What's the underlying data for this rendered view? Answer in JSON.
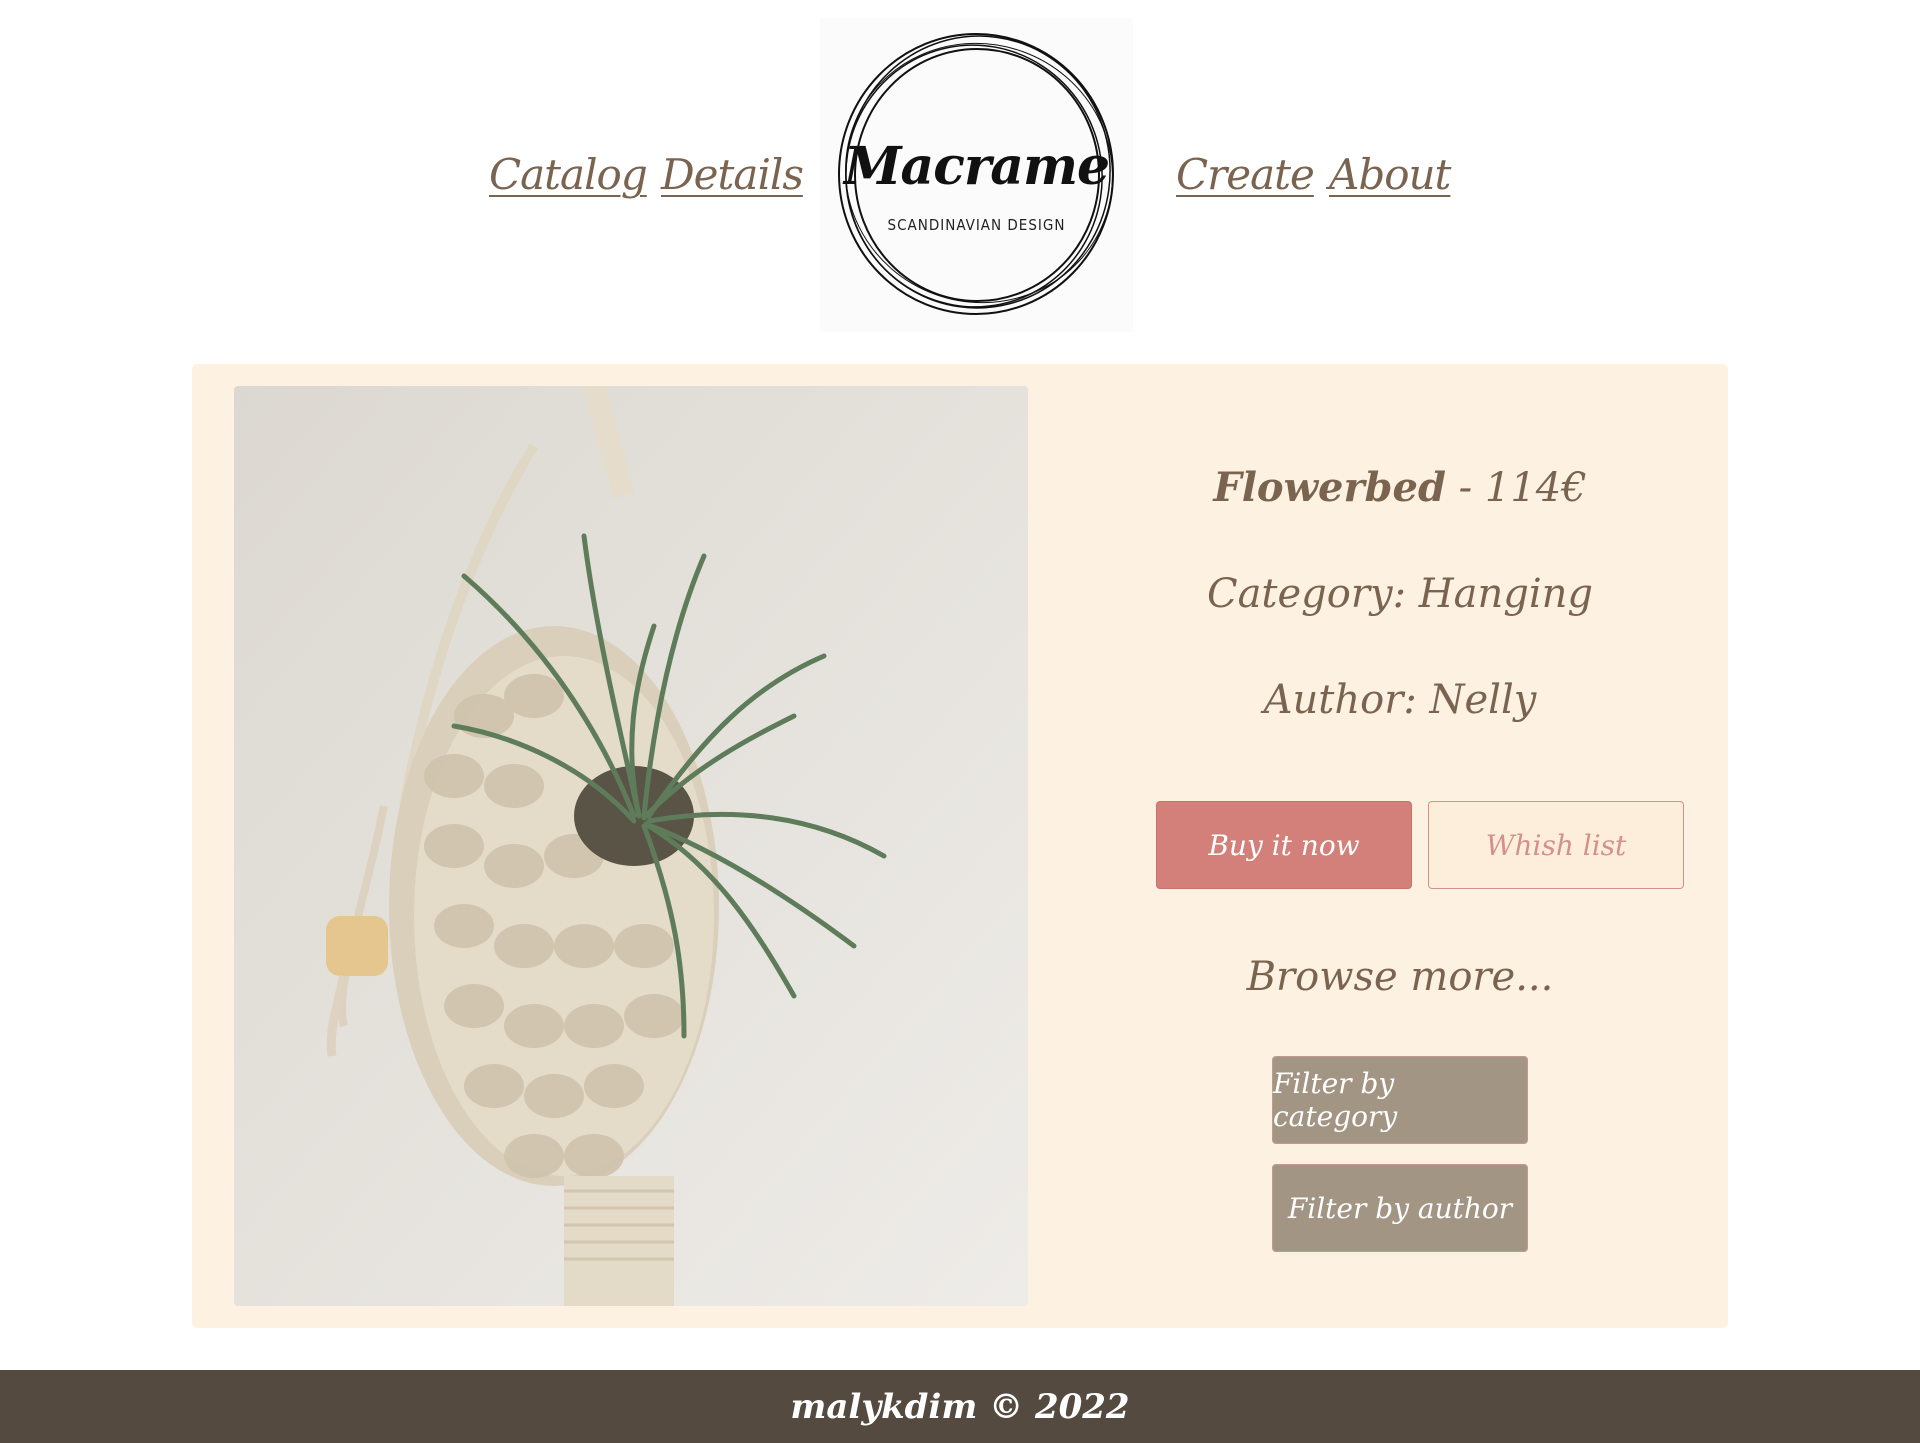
{
  "nav": {
    "left": [
      {
        "label": "Catalog"
      },
      {
        "label": "Details"
      }
    ],
    "right": [
      {
        "label": "Create"
      },
      {
        "label": "About"
      }
    ]
  },
  "logo": {
    "title": "Macrame",
    "subtitle": "SCANDINAVIAN DESIGN"
  },
  "product": {
    "name": "Flowerbed",
    "separator": " - ",
    "price": "114€",
    "category_text": "Category: Hanging",
    "author_text": "Author: Nelly",
    "buy_label": "Buy it now",
    "wish_label": "Whish list"
  },
  "browse": {
    "heading": "Browse more...",
    "filter_category_label": "Filter by category",
    "filter_author_label": "Filter by author"
  },
  "footer": {
    "text": "malykdim © 2022"
  },
  "colors": {
    "accent": "#d4807a",
    "card_bg": "#fdf1e2",
    "text": "#7a6450",
    "filter_btn": "#a39584",
    "footer_bg": "#554a3f"
  }
}
